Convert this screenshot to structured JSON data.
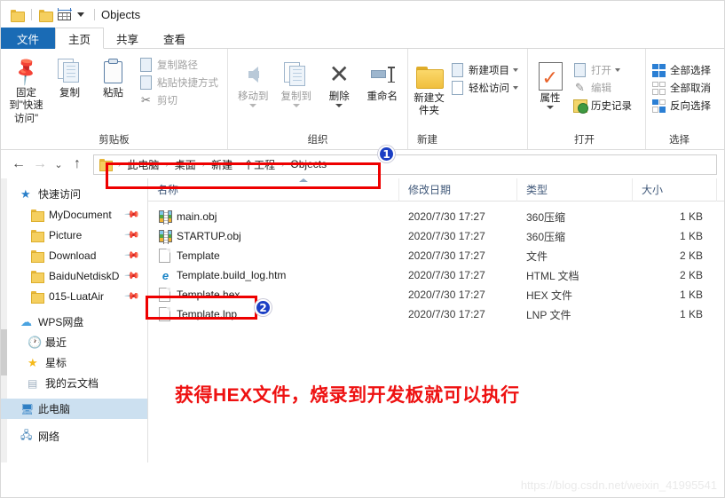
{
  "window": {
    "title": "Objects",
    "quick_access": [
      {
        "name": "folder-icon",
        "label": ""
      },
      {
        "name": "folder-icon",
        "label": ""
      },
      {
        "name": "properties-icon",
        "label": ""
      },
      {
        "name": "chevron-down-icon",
        "label": ""
      }
    ]
  },
  "tabs": [
    {
      "id": "file",
      "label": "文件"
    },
    {
      "id": "home",
      "label": "主页"
    },
    {
      "id": "share",
      "label": "共享"
    },
    {
      "id": "view",
      "label": "查看"
    }
  ],
  "ribbon": {
    "groups": [
      {
        "title": "剪贴板",
        "big": [
          {
            "label": "固定到\"快速访问\"",
            "icon": "pin-icon"
          },
          {
            "label": "复制",
            "icon": "copy-icon"
          },
          {
            "label": "粘贴",
            "icon": "paste-icon"
          }
        ],
        "small": [
          {
            "label": "复制路径",
            "icon": "copy-path-icon"
          },
          {
            "label": "粘贴快捷方式",
            "icon": "paste-shortcut-icon"
          },
          {
            "label": "剪切",
            "icon": "scissors-icon"
          }
        ]
      },
      {
        "title": "组织",
        "big": [
          {
            "label": "移动到",
            "icon": "move-to-icon"
          },
          {
            "label": "复制到",
            "icon": "copy-to-icon"
          },
          {
            "label": "删除",
            "icon": "delete-icon"
          },
          {
            "label": "重命名",
            "icon": "rename-icon"
          }
        ],
        "small": []
      },
      {
        "title": "新建",
        "big": [
          {
            "label": "新建文件夹",
            "icon": "new-folder-icon"
          }
        ],
        "small": [
          {
            "label": "新建项目",
            "icon": "new-item-icon"
          },
          {
            "label": "轻松访问",
            "icon": "easy-access-icon"
          }
        ]
      },
      {
        "title": "打开",
        "big": [
          {
            "label": "属性",
            "icon": "properties-icon"
          }
        ],
        "small": [
          {
            "label": "打开",
            "icon": "open-icon"
          },
          {
            "label": "编辑",
            "icon": "edit-icon"
          },
          {
            "label": "历史记录",
            "icon": "history-icon"
          }
        ]
      },
      {
        "title": "选择",
        "big": [],
        "small": [
          {
            "label": "全部选择",
            "icon": "select-all-icon"
          },
          {
            "label": "全部取消",
            "icon": "select-none-icon"
          },
          {
            "label": "反向选择",
            "icon": "invert-selection-icon"
          }
        ]
      }
    ]
  },
  "address": {
    "back": "←",
    "forward": "→",
    "recent": "⌄",
    "up": "↑",
    "crumbs": [
      "此电脑",
      "桌面",
      "新建一个工程",
      "Objects"
    ],
    "separator": "›"
  },
  "nav": {
    "items": [
      {
        "label": "快速访问",
        "icon": "star-pin-icon",
        "level": 0,
        "pinned": false,
        "selected": false
      },
      {
        "label": "MyDocument",
        "icon": "folder-icon",
        "level": 1,
        "pinned": true,
        "selected": false
      },
      {
        "label": "Picture",
        "icon": "folder-icon",
        "level": 1,
        "pinned": true,
        "selected": false
      },
      {
        "label": "Download",
        "icon": "folder-icon",
        "level": 1,
        "pinned": true,
        "selected": false
      },
      {
        "label": "BaiduNetdiskD",
        "icon": "folder-icon",
        "level": 1,
        "pinned": true,
        "selected": false
      },
      {
        "label": "015-LuatAir",
        "icon": "folder-icon",
        "level": 1,
        "pinned": true,
        "selected": false
      },
      {
        "label": "WPS网盘",
        "icon": "cloud-icon",
        "level": 0,
        "pinned": false,
        "selected": false
      },
      {
        "label": "最近",
        "icon": "clock-icon",
        "level": 1,
        "pinned": false,
        "selected": false
      },
      {
        "label": "星标",
        "icon": "star-icon",
        "level": 1,
        "pinned": false,
        "selected": false
      },
      {
        "label": "我的云文档",
        "icon": "document-icon",
        "level": 1,
        "pinned": false,
        "selected": false
      },
      {
        "label": "此电脑",
        "icon": "computer-icon",
        "level": 0,
        "pinned": false,
        "selected": true
      },
      {
        "label": "网络",
        "icon": "network-icon",
        "level": 0,
        "pinned": false,
        "selected": false
      }
    ]
  },
  "filelist": {
    "columns": [
      "名称",
      "修改日期",
      "类型",
      "大小"
    ],
    "rows": [
      {
        "name": "main.obj",
        "date": "2020/7/30 17:27",
        "type": "360压缩",
        "size": "1 KB",
        "icon": "zip-icon"
      },
      {
        "name": "STARTUP.obj",
        "date": "2020/7/30 17:27",
        "type": "360压缩",
        "size": "1 KB",
        "icon": "zip-icon"
      },
      {
        "name": "Template",
        "date": "2020/7/30 17:27",
        "type": "文件",
        "size": "2 KB",
        "icon": "blank-file-icon"
      },
      {
        "name": "Template.build_log.htm",
        "date": "2020/7/30 17:27",
        "type": "HTML 文档",
        "size": "2 KB",
        "icon": "html-file-icon"
      },
      {
        "name": "Template.hex",
        "date": "2020/7/30 17:27",
        "type": "HEX 文件",
        "size": "1 KB",
        "icon": "blank-file-icon"
      },
      {
        "name": "Template.lnp",
        "date": "2020/7/30 17:27",
        "type": "LNP 文件",
        "size": "1 KB",
        "icon": "blank-file-icon"
      }
    ]
  },
  "annotations": {
    "badge1": "1",
    "badge2": "2",
    "note": "获得HEX文件，烧录到开发板就可以执行",
    "accent_color": "#ee0000",
    "badge_color": "#1b3fc4"
  },
  "watermark": "https://blog.csdn.net/weixin_41995541"
}
